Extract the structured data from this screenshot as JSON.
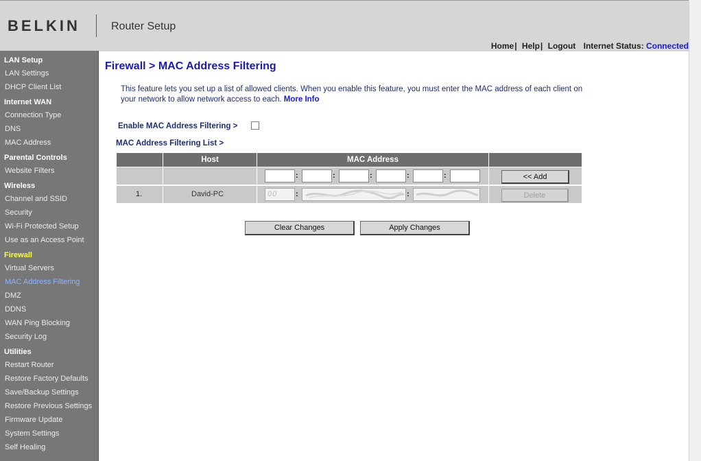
{
  "header": {
    "logo": "BELKIN",
    "product": "Router Setup",
    "links": [
      "Home",
      "Help",
      "Logout"
    ],
    "status_label": "Internet Status:",
    "status_value": "Connected"
  },
  "sidebar": {
    "sections": [
      {
        "title": "LAN Setup",
        "items": [
          "LAN Settings",
          "DHCP Client List"
        ]
      },
      {
        "title": "Internet WAN",
        "items": [
          "Connection Type",
          "DNS",
          "MAC Address"
        ]
      },
      {
        "title": "Parental Controls",
        "items": [
          "Website Filters"
        ]
      },
      {
        "title": "Wireless",
        "items": [
          "Channel and SSID",
          "Security",
          "Wi-Fi Protected Setup",
          "Use as an Access Point"
        ]
      },
      {
        "title": "Firewall",
        "items": [
          "Virtual Servers",
          "MAC Address Filtering",
          "DMZ",
          "DDNS",
          "WAN Ping Blocking",
          "Security Log"
        ]
      },
      {
        "title": "Utilities",
        "items": [
          "Restart Router",
          "Restore Factory Defaults",
          "Save/Backup Settings",
          "Restore Previous Settings",
          "Firmware Update",
          "System Settings",
          "Self Healing"
        ]
      }
    ],
    "active_item": "MAC Address Filtering"
  },
  "main": {
    "title": "Firewall > MAC Address Filtering",
    "description": "This feature lets you set up a list of allowed clients. When you enable this feature, you must enter the MAC address of each client on your network to allow network access to each.",
    "more_info": "More Info",
    "enable_label": "Enable MAC Address Filtering >",
    "enable_checked": false,
    "list_label": "MAC Address Filtering List >",
    "table": {
      "headers": [
        "Host",
        "MAC Address"
      ],
      "add_button": "<< Add",
      "rows": [
        {
          "num": "1.",
          "host": "David-PC",
          "first_octet": "00",
          "delete_button": "Delete"
        }
      ]
    },
    "clear_button": "Clear Changes",
    "apply_button": "Apply Changes"
  },
  "colors": {
    "title_blue": "#1a1ab0",
    "sidebar_bg": "#777777",
    "firewall_yellow": "#ffff33",
    "active_link": "#8fb4ff",
    "connected_blue": "#1a1ad6"
  }
}
